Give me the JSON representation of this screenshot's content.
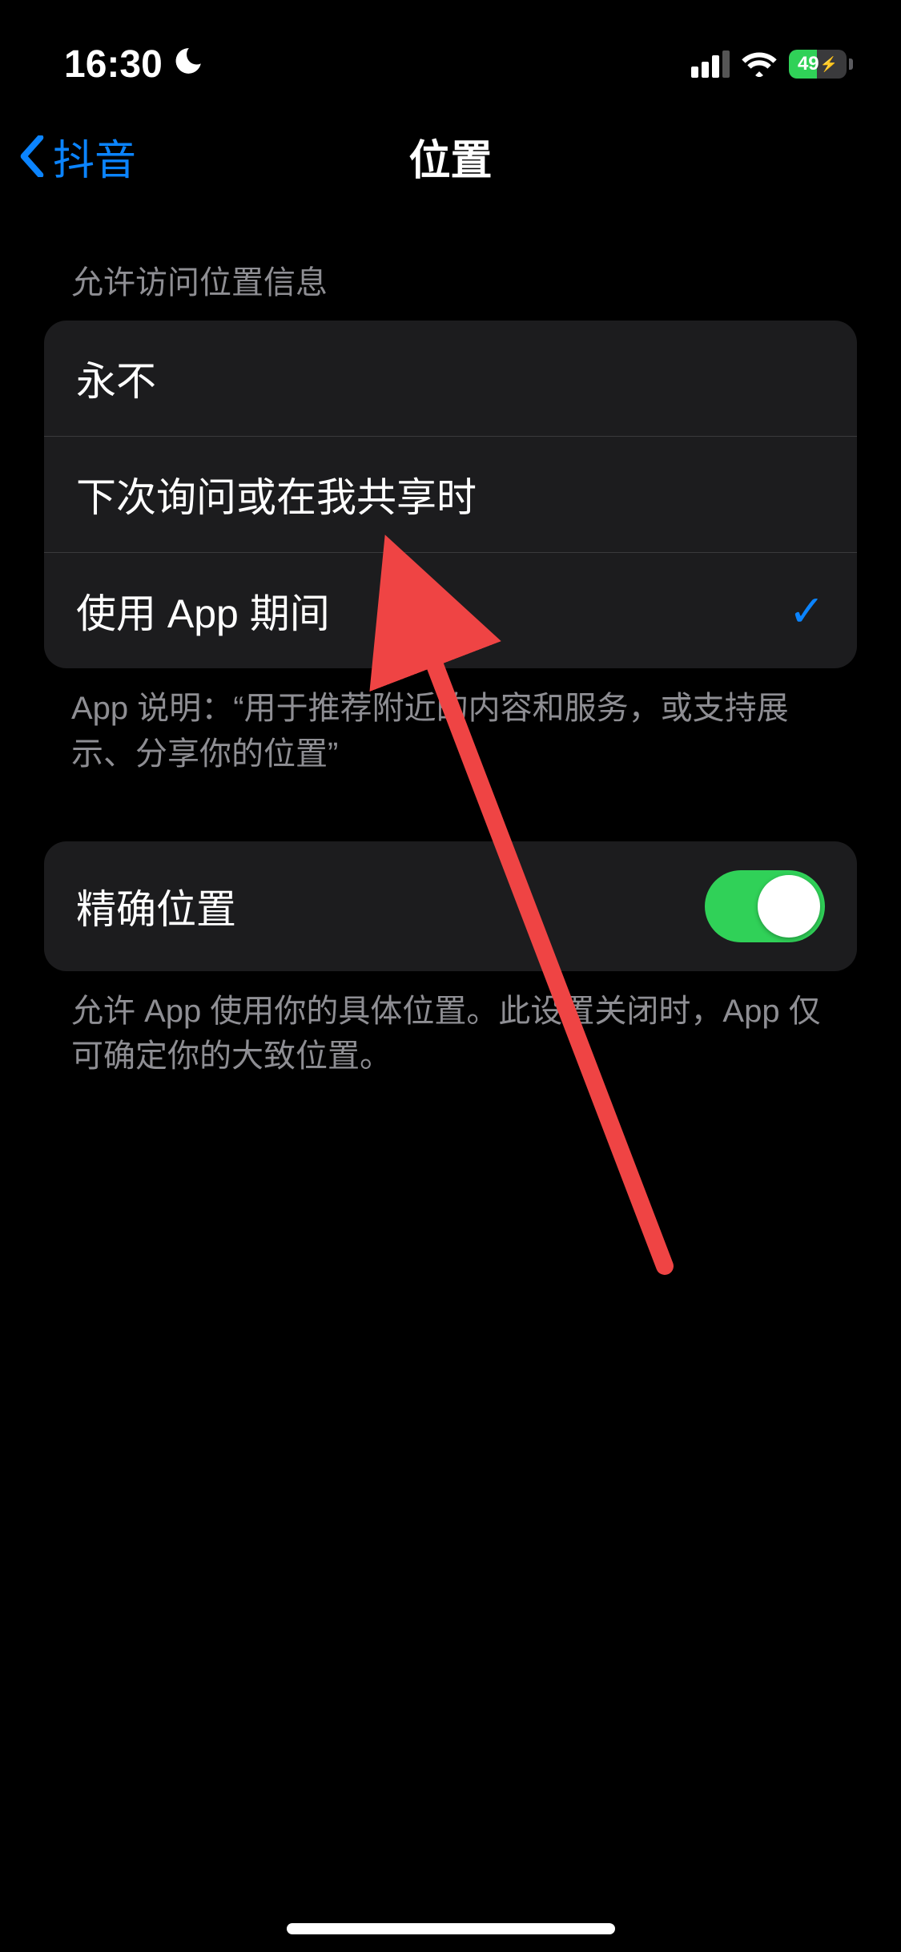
{
  "statusBar": {
    "time": "16:30",
    "batteryPercent": "49"
  },
  "nav": {
    "backLabel": "抖音",
    "title": "位置"
  },
  "locationAccess": {
    "header": "允许访问位置信息",
    "options": [
      {
        "label": "永不",
        "selected": false
      },
      {
        "label": "下次询问或在我共享时",
        "selected": false
      },
      {
        "label": "使用 App 期间",
        "selected": true
      }
    ],
    "footer": "App 说明：“用于推荐附近的内容和服务，或支持展示、分享你的位置”"
  },
  "preciseLocation": {
    "label": "精确位置",
    "enabled": true,
    "footer": "允许 App 使用你的具体位置。此设置关闭时，App 仅可确定你的大致位置。"
  }
}
